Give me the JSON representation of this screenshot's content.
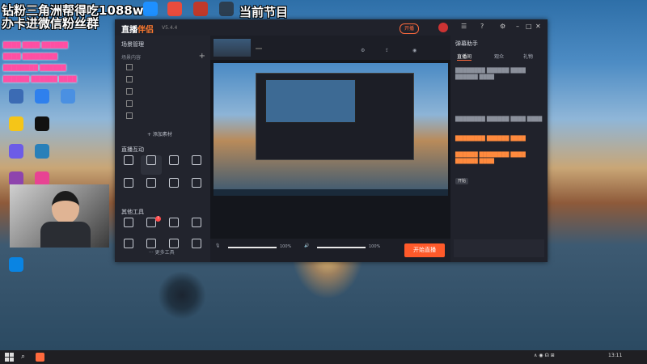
{
  "overlay": {
    "line1": "钻粉三角洲帮得吃1088w",
    "line2": "办卡进微信粉丝群",
    "right_text": "当前节目"
  },
  "desktop_icons": [
    {
      "id": "d1",
      "label": ""
    },
    {
      "id": "d2",
      "label": ""
    },
    {
      "id": "d3",
      "label": ""
    },
    {
      "id": "d4",
      "label": ""
    },
    {
      "id": "d5",
      "label": ""
    },
    {
      "id": "d6",
      "label": ""
    },
    {
      "id": "d7",
      "label": ""
    },
    {
      "id": "d8",
      "label": ""
    },
    {
      "id": "d9",
      "label": ""
    },
    {
      "id": "d10",
      "label": ""
    }
  ],
  "app": {
    "logo_main": "直播",
    "logo_accent": "伴侣",
    "version": "V5.4.4",
    "upgrade_label": "开播",
    "left": {
      "scene_title": "场景管理",
      "source_title": "场景内容",
      "scenes": [
        "",
        "",
        "",
        "",
        ""
      ],
      "add_source": "+ 添加素材",
      "tools_title": "直播互动",
      "tools_row1": [
        "",
        "",
        "",
        ""
      ],
      "tools_row2": [
        "",
        "",
        "",
        ""
      ],
      "more_title": "其他工具",
      "tools_row3": [
        "",
        "",
        "",
        ""
      ],
      "tools_row4": [
        "",
        "",
        "",
        ""
      ],
      "more_label": "··· 更多工具"
    },
    "mid": {
      "stream_title": "",
      "tag": "",
      "start_button": "开始直播",
      "volume1": "100%",
      "volume2": "100%",
      "status_text": ""
    },
    "right": {
      "title": "弹幕助手",
      "tabs": [
        "直播间",
        "观众",
        "礼物"
      ],
      "start_tip": "开始"
    }
  },
  "taskbar": {
    "time": "13:11",
    "date": ""
  },
  "colors": {
    "accent": "#ff5a2a",
    "panel": "#1c1e26",
    "pink_text": "#ff4fa3"
  }
}
